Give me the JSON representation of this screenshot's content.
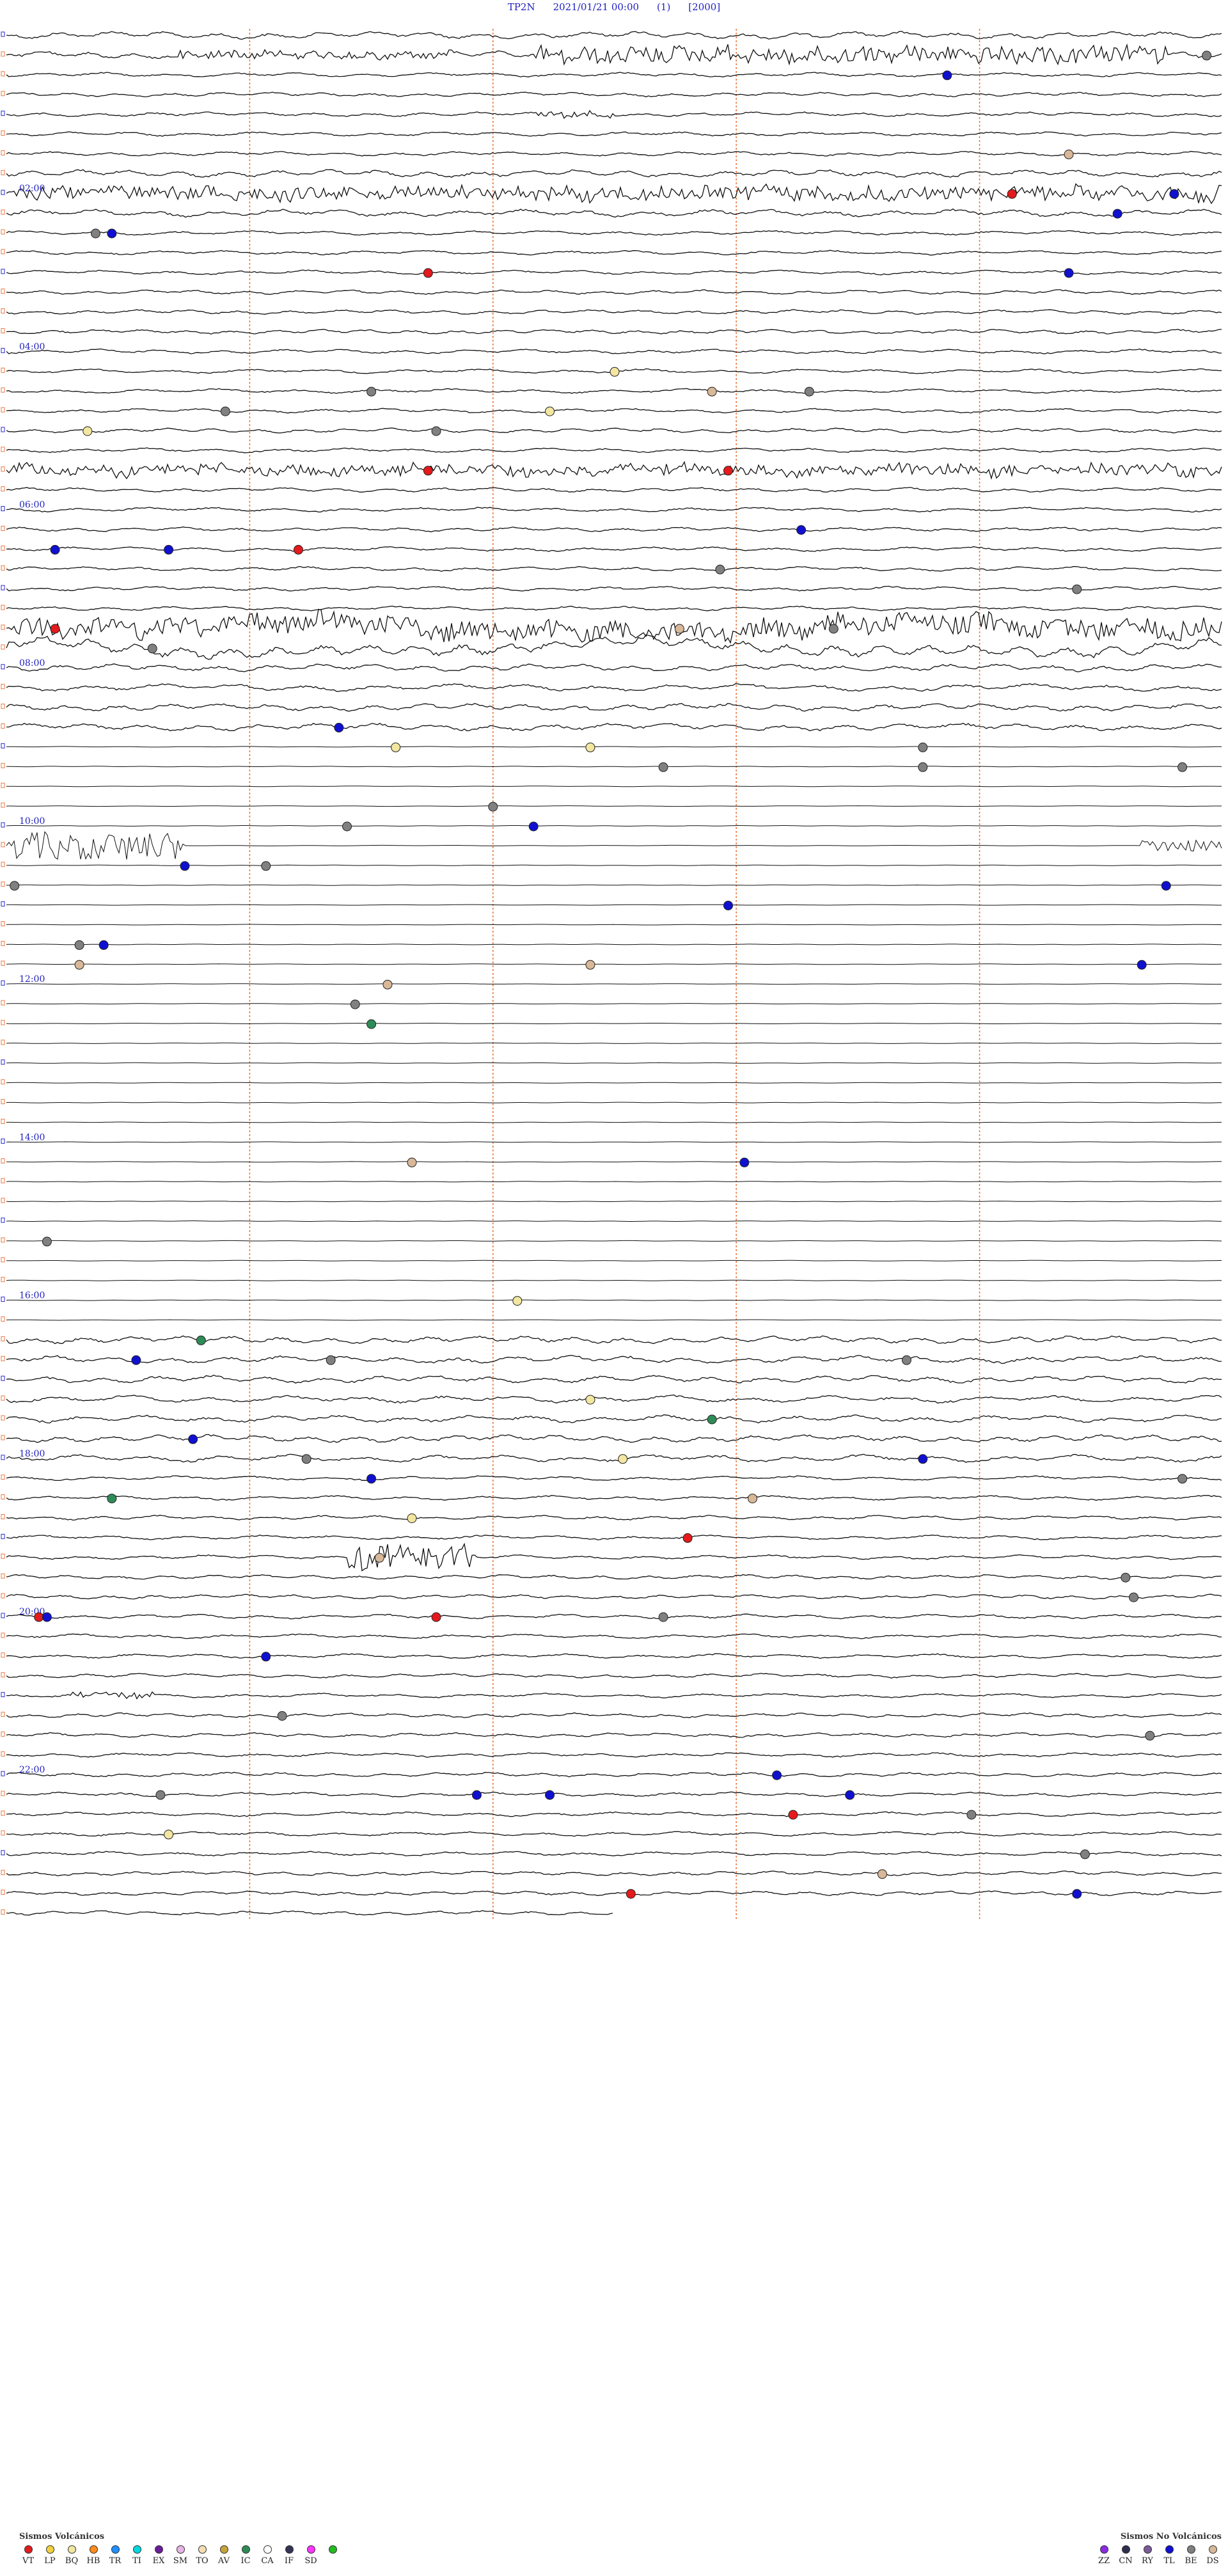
{
  "header": {
    "station": "TP2N",
    "datetime": "2021/01/21 00:00",
    "component": "(1)",
    "scale": "[2000]"
  },
  "chart_data": {
    "type": "helicorder",
    "rows_per_hour": 4,
    "hours": 24,
    "minutes_per_row": 15,
    "time_labels": [
      {
        "row": 8,
        "text": "02:00"
      },
      {
        "row": 16,
        "text": "04:00"
      },
      {
        "row": 24,
        "text": "06:00"
      },
      {
        "row": 32,
        "text": "08:00"
      },
      {
        "row": 40,
        "text": "10:00"
      },
      {
        "row": 48,
        "text": "12:00"
      },
      {
        "row": 56,
        "text": "14:00"
      },
      {
        "row": 64,
        "text": "16:00"
      },
      {
        "row": 72,
        "text": "18:00"
      },
      {
        "row": 80,
        "text": "20:00"
      },
      {
        "row": 88,
        "text": "22:00"
      }
    ],
    "gridline_minutes": [
      3,
      6,
      9,
      12
    ],
    "activity_segments": [
      {
        "row_start": 0,
        "row_end": 2,
        "level": 2
      },
      {
        "row_start": 2,
        "row_end": 7,
        "level": 1
      },
      {
        "row_start": 7,
        "row_end": 10,
        "level": 2
      },
      {
        "row_start": 10,
        "row_end": 22,
        "level": 1
      },
      {
        "row_start": 22,
        "row_end": 23,
        "level": 2
      },
      {
        "row_start": 23,
        "row_end": 30,
        "level": 1
      },
      {
        "row_start": 30,
        "row_end": 32,
        "level": 3
      },
      {
        "row_start": 32,
        "row_end": 36,
        "level": 2
      },
      {
        "row_start": 36,
        "row_end": 66,
        "level": 0
      },
      {
        "row_start": 66,
        "row_end": 73,
        "level": 2
      },
      {
        "row_start": 73,
        "row_end": 97,
        "level": 1
      }
    ],
    "bursts": [
      {
        "row": 1,
        "minute_start": 6.5,
        "minute_end": 14.3,
        "amp": 12
      },
      {
        "row": 1,
        "minute_start": 2,
        "minute_end": 5.5,
        "amp": 6
      },
      {
        "row": 4,
        "minute_start": 6.5,
        "minute_end": 7.5,
        "amp": 5
      },
      {
        "row": 8,
        "minute_start": 0,
        "minute_end": 14.8,
        "amp": 10
      },
      {
        "row": 8,
        "minute_start": 14.8,
        "minute_end": 15,
        "amp": 14
      },
      {
        "row": 22,
        "minute_start": 0,
        "minute_end": 15,
        "amp": 8
      },
      {
        "row": 30,
        "minute_start": 0,
        "minute_end": 15,
        "amp": 14
      },
      {
        "row": 41,
        "minute_start": 0,
        "minute_end": 2.2,
        "amp": 22
      },
      {
        "row": 41,
        "minute_start": 14,
        "minute_end": 15,
        "amp": 10
      },
      {
        "row": 77,
        "minute_start": 4.2,
        "minute_end": 5.8,
        "amp": 20
      },
      {
        "row": 84,
        "minute_start": 0.8,
        "minute_end": 1.8,
        "amp": 5
      }
    ],
    "events": [
      {
        "row": 1,
        "minute": 14.8,
        "class": "BE"
      },
      {
        "row": 2,
        "minute": 11.6,
        "class": "TL"
      },
      {
        "row": 6,
        "minute": 13.1,
        "class": "DS"
      },
      {
        "row": 8,
        "minute": 12.4,
        "class": "VT"
      },
      {
        "row": 8,
        "minute": 14.4,
        "class": "TL"
      },
      {
        "row": 9,
        "minute": 13.7,
        "class": "TL"
      },
      {
        "row": 10,
        "minute": 1.3,
        "class": "TL"
      },
      {
        "row": 10,
        "minute": 1.1,
        "class": "BE"
      },
      {
        "row": 12,
        "minute": 5.2,
        "class": "VT"
      },
      {
        "row": 12,
        "minute": 13.1,
        "class": "TL"
      },
      {
        "row": 17,
        "minute": 7.5,
        "class": "BQ"
      },
      {
        "row": 18,
        "minute": 4.5,
        "class": "BE"
      },
      {
        "row": 18,
        "minute": 8.7,
        "class": "DS"
      },
      {
        "row": 18,
        "minute": 9.9,
        "class": "BE"
      },
      {
        "row": 19,
        "minute": 2.7,
        "class": "BE"
      },
      {
        "row": 19,
        "minute": 6.7,
        "class": "BQ"
      },
      {
        "row": 20,
        "minute": 1,
        "class": "BQ"
      },
      {
        "row": 20,
        "minute": 5.3,
        "class": "BE"
      },
      {
        "row": 22,
        "minute": 5.2,
        "class": "VT"
      },
      {
        "row": 22,
        "minute": 8.9,
        "class": "VT"
      },
      {
        "row": 25,
        "minute": 9.8,
        "class": "TL"
      },
      {
        "row": 26,
        "minute": 0.6,
        "class": "TL"
      },
      {
        "row": 26,
        "minute": 2,
        "class": "TL"
      },
      {
        "row": 26,
        "minute": 3.6,
        "class": "VT"
      },
      {
        "row": 27,
        "minute": 8.8,
        "class": "BE"
      },
      {
        "row": 28,
        "minute": 13.2,
        "class": "BE"
      },
      {
        "row": 30,
        "minute": 0.6,
        "class": "VT"
      },
      {
        "row": 30,
        "minute": 10.2,
        "class": "BE"
      },
      {
        "row": 30,
        "minute": 8.3,
        "class": "DS"
      },
      {
        "row": 31,
        "minute": 1.8,
        "class": "BE"
      },
      {
        "row": 35,
        "minute": 4.1,
        "class": "TL"
      },
      {
        "row": 36,
        "minute": 4.8,
        "class": "BQ"
      },
      {
        "row": 36,
        "minute": 7.2,
        "class": "BQ"
      },
      {
        "row": 36,
        "minute": 11.3,
        "class": "BE"
      },
      {
        "row": 37,
        "minute": 8.1,
        "class": "BE"
      },
      {
        "row": 37,
        "minute": 11.3,
        "class": "BE"
      },
      {
        "row": 37,
        "minute": 14.5,
        "class": "BE"
      },
      {
        "row": 39,
        "minute": 6,
        "class": "BE"
      },
      {
        "row": 40,
        "minute": 4.2,
        "class": "BE"
      },
      {
        "row": 40,
        "minute": 6.5,
        "class": "TL"
      },
      {
        "row": 42,
        "minute": 3.2,
        "class": "BE"
      },
      {
        "row": 42,
        "minute": 2.2,
        "class": "TL"
      },
      {
        "row": 43,
        "minute": 0.1,
        "class": "BE"
      },
      {
        "row": 43,
        "minute": 14.3,
        "class": "TL"
      },
      {
        "row": 44,
        "minute": 8.9,
        "class": "TL"
      },
      {
        "row": 46,
        "minute": 0.9,
        "class": "BE"
      },
      {
        "row": 46,
        "minute": 1.2,
        "class": "TL"
      },
      {
        "row": 47,
        "minute": 0.9,
        "class": "DS"
      },
      {
        "row": 47,
        "minute": 7.2,
        "class": "DS"
      },
      {
        "row": 47,
        "minute": 14,
        "class": "TL"
      },
      {
        "row": 48,
        "minute": 4.7,
        "class": "DS"
      },
      {
        "row": 49,
        "minute": 4.3,
        "class": "BE"
      },
      {
        "row": 50,
        "minute": 4.5,
        "class": "IC"
      },
      {
        "row": 57,
        "minute": 5,
        "class": "DS"
      },
      {
        "row": 57,
        "minute": 9.1,
        "class": "TL"
      },
      {
        "row": 61,
        "minute": 0.5,
        "class": "BE"
      },
      {
        "row": 64,
        "minute": 6.3,
        "class": "BQ"
      },
      {
        "row": 66,
        "minute": 2.4,
        "class": "IC"
      },
      {
        "row": 67,
        "minute": 1.6,
        "class": "TL"
      },
      {
        "row": 67,
        "minute": 4,
        "class": "BE"
      },
      {
        "row": 67,
        "minute": 11.1,
        "class": "BE"
      },
      {
        "row": 69,
        "minute": 7.2,
        "class": "BQ"
      },
      {
        "row": 70,
        "minute": 8.7,
        "class": "IC"
      },
      {
        "row": 71,
        "minute": 2.3,
        "class": "TL"
      },
      {
        "row": 72,
        "minute": 3.7,
        "class": "BE"
      },
      {
        "row": 72,
        "minute": 7.6,
        "class": "BQ"
      },
      {
        "row": 72,
        "minute": 11.3,
        "class": "TL"
      },
      {
        "row": 73,
        "minute": 4.5,
        "class": "TL"
      },
      {
        "row": 73,
        "minute": 14.5,
        "class": "BE"
      },
      {
        "row": 74,
        "minute": 1.3,
        "class": "IC"
      },
      {
        "row": 74,
        "minute": 9.2,
        "class": "DS"
      },
      {
        "row": 75,
        "minute": 5,
        "class": "BQ"
      },
      {
        "row": 76,
        "minute": 8.4,
        "class": "VT"
      },
      {
        "row": 77,
        "minute": 4.6,
        "class": "DS"
      },
      {
        "row": 78,
        "minute": 13.8,
        "class": "BE"
      },
      {
        "row": 79,
        "minute": 13.9,
        "class": "BE"
      },
      {
        "row": 80,
        "minute": 8.1,
        "class": "BE"
      },
      {
        "row": 80,
        "minute": 0.4,
        "class": "VT"
      },
      {
        "row": 80,
        "minute": 0.5,
        "class": "TL"
      },
      {
        "row": 80,
        "minute": 5.3,
        "class": "VT"
      },
      {
        "row": 82,
        "minute": 3.2,
        "class": "TL"
      },
      {
        "row": 85,
        "minute": 3.4,
        "class": "BE"
      },
      {
        "row": 86,
        "minute": 14.1,
        "class": "BE"
      },
      {
        "row": 88,
        "minute": 9.5,
        "class": "TL"
      },
      {
        "row": 89,
        "minute": 1.9,
        "class": "BE"
      },
      {
        "row": 89,
        "minute": 5.8,
        "class": "TL"
      },
      {
        "row": 89,
        "minute": 6.7,
        "class": "TL"
      },
      {
        "row": 89,
        "minute": 10.4,
        "class": "TL"
      },
      {
        "row": 90,
        "minute": 9.7,
        "class": "VT"
      },
      {
        "row": 90,
        "minute": 11.9,
        "class": "BE"
      },
      {
        "row": 91,
        "minute": 2,
        "class": "BQ"
      },
      {
        "row": 92,
        "minute": 13.3,
        "class": "BE"
      },
      {
        "row": 93,
        "minute": 10.8,
        "class": "DS"
      },
      {
        "row": 94,
        "minute": 7.7,
        "class": "VT"
      },
      {
        "row": 94,
        "minute": 13.2,
        "class": "TL"
      }
    ]
  },
  "legend_volcanic": {
    "title": "Sismos Volcánicos",
    "items": [
      {
        "code": "VT",
        "color": "#e41a1c"
      },
      {
        "code": "LP",
        "color": "#f4d03f"
      },
      {
        "code": "BQ",
        "color": "#f2e6a0"
      },
      {
        "code": "HB",
        "color": "#ff8c1a"
      },
      {
        "code": "TR",
        "color": "#1e90ff"
      },
      {
        "code": "TI",
        "color": "#00d8e0"
      },
      {
        "code": "EX",
        "color": "#6a1b9a"
      },
      {
        "code": "SM",
        "color": "#e8b4e8"
      },
      {
        "code": "TO",
        "color": "#f5deb3"
      },
      {
        "code": "AV",
        "color": "#c6a43a"
      },
      {
        "code": "IC",
        "color": "#2e8b57"
      },
      {
        "code": "CA",
        "color": "#ffffff"
      },
      {
        "code": "IF",
        "color": "#333355"
      },
      {
        "code": "SD",
        "color": "#ff33ff"
      },
      {
        "code": "",
        "color": "#22bb22"
      }
    ]
  },
  "legend_nonvolcanic": {
    "title": "Sismos No Volcánicos",
    "items": [
      {
        "code": "ZZ",
        "color": "#8a2be2"
      },
      {
        "code": "CN",
        "color": "#2e2e4e"
      },
      {
        "code": "RY",
        "color": "#7a5a9a"
      },
      {
        "code": "TL",
        "color": "#1010d0"
      },
      {
        "code": "BE",
        "color": "#808080"
      },
      {
        "code": "DS",
        "color": "#d8b898"
      }
    ]
  },
  "colors": {
    "trace": "#111111",
    "gridline": "#e87a40",
    "label": "#1f1fbf"
  }
}
